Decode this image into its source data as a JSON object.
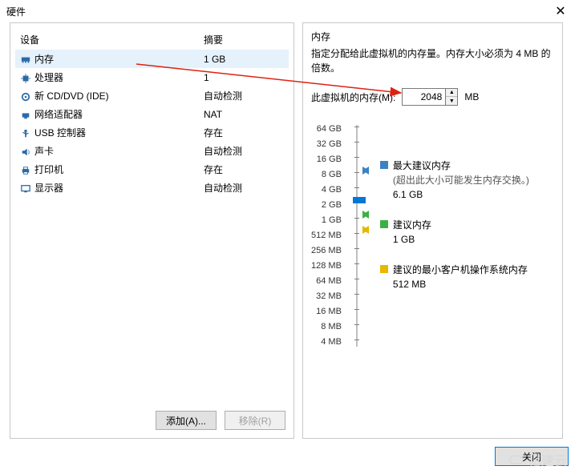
{
  "window": {
    "title": "硬件"
  },
  "headers": {
    "device": "设备",
    "summary": "摘要"
  },
  "hardware": [
    {
      "icon": "memory",
      "name": "内存",
      "summary": "1 GB",
      "selected": true
    },
    {
      "icon": "cpu",
      "name": "处理器",
      "summary": "1",
      "selected": false
    },
    {
      "icon": "cd",
      "name": "新 CD/DVD (IDE)",
      "summary": "自动检测",
      "selected": false
    },
    {
      "icon": "network",
      "name": "网络适配器",
      "summary": "NAT",
      "selected": false
    },
    {
      "icon": "usb",
      "name": "USB 控制器",
      "summary": "存在",
      "selected": false
    },
    {
      "icon": "sound",
      "name": "声卡",
      "summary": "自动检测",
      "selected": false
    },
    {
      "icon": "printer",
      "name": "打印机",
      "summary": "存在",
      "selected": false
    },
    {
      "icon": "display",
      "name": "显示器",
      "summary": "自动检测",
      "selected": false
    }
  ],
  "buttons": {
    "add": "添加(A)...",
    "remove": "移除(R)"
  },
  "memory": {
    "section_title": "内存",
    "desc": "指定分配给此虚拟机的内存量。内存大小必须为 4 MB 的倍数。",
    "label": "此虚拟机的内存(M):",
    "value": "2048",
    "unit": "MB",
    "ticks": [
      "64 GB",
      "32 GB",
      "16 GB",
      "8 GB",
      "4 GB",
      "2 GB",
      "1 GB",
      "512 MB",
      "256 MB",
      "128 MB",
      "64 MB",
      "32 MB",
      "16 MB",
      "8 MB",
      "4 MB"
    ]
  },
  "legend": {
    "max": {
      "color": "#3b82c4",
      "title": "最大建议内存",
      "note": "(超出此大小可能发生内存交换。)",
      "value": "6.1 GB"
    },
    "rec": {
      "color": "#3bb143",
      "title": "建议内存",
      "value": "1 GB"
    },
    "min": {
      "color": "#e6b800",
      "title": "建议的最小客户机操作系统内存",
      "value": "512 MB"
    }
  },
  "footer": {
    "close": "关闭"
  },
  "watermark": "亿速云"
}
